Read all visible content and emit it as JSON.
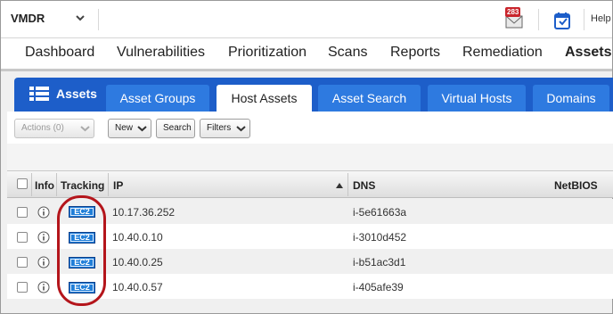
{
  "topbar": {
    "app_name": "VMDR",
    "notification_count": "283",
    "help_label": "Help"
  },
  "main_nav": {
    "items": [
      "Dashboard",
      "Vulnerabilities",
      "Prioritization",
      "Scans",
      "Reports",
      "Remediation",
      "Assets"
    ],
    "active": "Assets"
  },
  "module": {
    "title": "Assets",
    "tabs": [
      "Asset Groups",
      "Host Assets",
      "Asset Search",
      "Virtual Hosts",
      "Domains"
    ],
    "active_tab": "Host Assets"
  },
  "toolbar": {
    "actions_label": "Actions (0)",
    "new_label": "New",
    "search_label": "Search",
    "filters_label": "Filters"
  },
  "table": {
    "columns": [
      "Info",
      "Tracking",
      "IP",
      "DNS",
      "NetBIOS"
    ],
    "sorted_column": "IP",
    "rows": [
      {
        "tracking": "EC2",
        "ip": "10.17.36.252",
        "dns": "i-5e61663a"
      },
      {
        "tracking": "EC2",
        "ip": "10.40.0.10",
        "dns": "i-3010d452"
      },
      {
        "tracking": "EC2",
        "ip": "10.40.0.25",
        "dns": "i-b51ac3d1"
      },
      {
        "tracking": "EC2",
        "ip": "10.40.0.57",
        "dns": "i-405afe39"
      }
    ]
  },
  "colors": {
    "tab_strip": "#1d5ec9",
    "tab_inactive": "#2e7ae0",
    "ec2_badge": "#1f7ed8",
    "highlight_ring": "#b4151b",
    "notification_badge": "#c9252c"
  },
  "icons": [
    "chevron-down-icon",
    "mail-icon",
    "calendar-icon",
    "grid-list-icon",
    "info-icon",
    "sort-asc-icon"
  ]
}
